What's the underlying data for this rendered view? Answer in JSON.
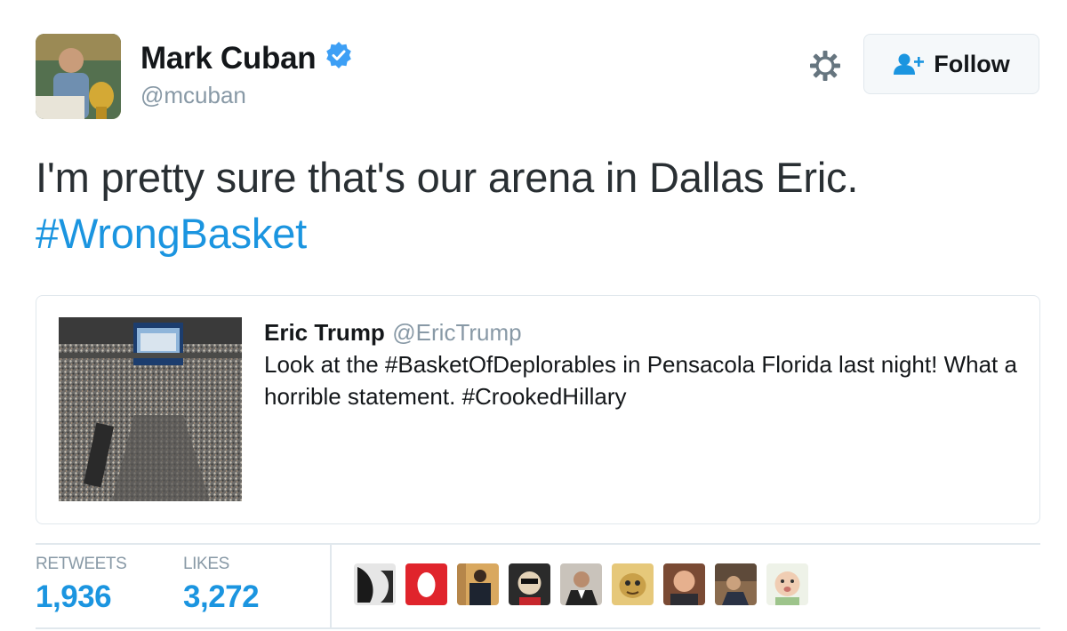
{
  "author": {
    "display_name": "Mark Cuban",
    "handle": "@mcuban",
    "verified": true,
    "avatar_icon": "profile-photo"
  },
  "follow_button": {
    "label": "Follow",
    "icon": "add-user-icon"
  },
  "settings": {
    "icon": "gear-icon"
  },
  "tweet": {
    "text": "I'm pretty sure that's our arena in Dallas Eric.",
    "hashtag": "#WrongBasket"
  },
  "quoted_tweet": {
    "name": "Eric Trump",
    "handle": "@EricTrump",
    "text_before": "Look at the ",
    "hashtag1": "#BasketOfDeplorables",
    "text_middle": " in Pensacola Florida last night! What a horrible statement. ",
    "hashtag2": "#CrookedHillary",
    "media_icon": "arena-photo"
  },
  "stats": {
    "retweets_label": "RETWEETS",
    "retweets_value": "1,936",
    "likes_label": "LIKES",
    "likes_value": "3,272"
  },
  "colors": {
    "link": "#1b95e0",
    "muted": "#8899a6",
    "border": "#e1e8ed"
  }
}
